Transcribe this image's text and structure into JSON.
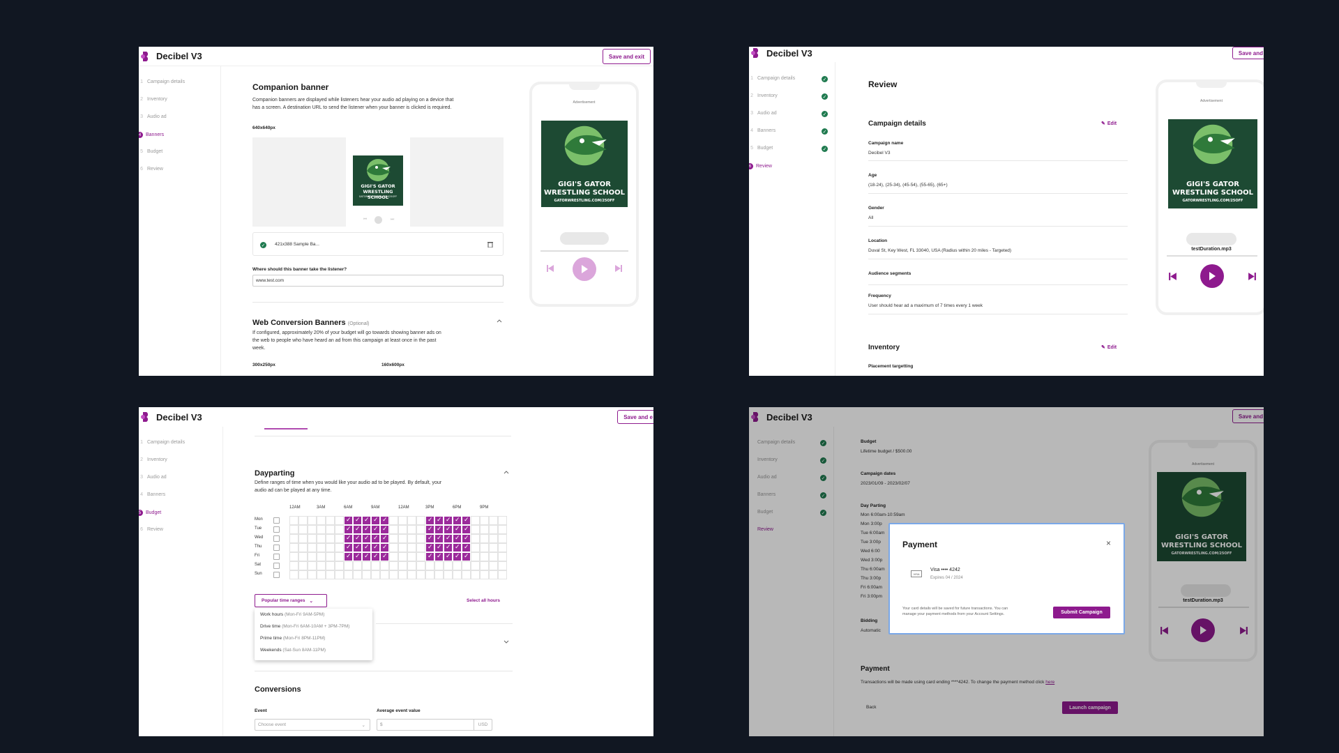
{
  "app": {
    "title": "Decibel V3",
    "save_exit": "Save and exit",
    "save_short": "Save and",
    "save_mid": "Save and e"
  },
  "colors": {
    "accent": "#8e1a8e",
    "background": "#111722",
    "check": "#1f7a4f"
  },
  "steps": [
    "Campaign details",
    "Inventory",
    "Audio ad",
    "Banners",
    "Budget",
    "Review"
  ],
  "step_numbers": [
    "1",
    "2",
    "3",
    "4",
    "5",
    "6"
  ],
  "ad_preview": {
    "advertisement": "Advertisement",
    "art_line1": "GIGI'S GATOR",
    "art_line2": "WRESTLING SCHOOL",
    "art_url": "GATORWRESTLING.COM/25OFF",
    "track_name": "testDuration.mp3"
  },
  "panel1": {
    "title": "Companion banner",
    "desc1": "Companion banners are displayed while listeners hear your audio ad playing on a device that",
    "desc2": "has a screen. A destination URL to send the listener when your banner is clicked is required.",
    "size_label": "640x640px",
    "file_name": "421x388 Sample Ba...",
    "url_label": "Where should this banner take the listener?",
    "url_value": "www.test.com",
    "web_title": "Web Conversion Banners",
    "web_optional": "(Optional)",
    "web_desc1": "If configured, approximately 20% of your budget will go towards showing banner ads on",
    "web_desc2": "the web to people who have heard an ad from this campaign at least once in the past",
    "web_desc3": "week.",
    "size_a": "300x250px",
    "size_b": "160x600px"
  },
  "panel2": {
    "title": "Review",
    "section1": "Campaign details",
    "edit": "Edit",
    "fields": [
      {
        "label": "Campaign name",
        "value": "Decibel V3"
      },
      {
        "label": "Age",
        "value": "(18-24), (25-34), (45-54), (55-65), (65+)"
      },
      {
        "label": "Gender",
        "value": "All"
      },
      {
        "label": "Location",
        "value": "Duval St, Key West, FL 33040, USA (Radius within 20 miles - Targeted)"
      },
      {
        "label": "Audience segments",
        "value": ""
      },
      {
        "label": "Frequency",
        "value": "User should hear ad a maximum of 7 times every 1 week"
      }
    ],
    "section2": "Inventory",
    "placement": "Placement targetting"
  },
  "panel3": {
    "title": "Dayparting",
    "desc1": "Define ranges of time when you would like your audio ad to be played. By default, your",
    "desc2": "audio ad can be played at any time.",
    "hours": [
      "12AM",
      "3AM",
      "6AM",
      "9AM",
      "12AM",
      "3PM",
      "6PM",
      "9PM"
    ],
    "days": [
      "Mon",
      "Tue",
      "Wed",
      "Thu",
      "Fri",
      "Sat",
      "Sun"
    ],
    "active_days": [
      "Mon",
      "Tue",
      "Wed",
      "Thu",
      "Fri"
    ],
    "active_hours": [
      6,
      7,
      8,
      9,
      10,
      15,
      16,
      17,
      18,
      19
    ],
    "popular": "Popular time ranges",
    "select_all": "Select all hours",
    "options": [
      {
        "name": "Work hours",
        "range": "(Mon-Fri 9AM-5PM)"
      },
      {
        "name": "Drive time",
        "range": "(Mon-Fri 6AM-10AM + 3PM-7PM)"
      },
      {
        "name": "Prime time",
        "range": "(Mon-Fri 8PM-11PM)"
      },
      {
        "name": "Weekends",
        "range": "(Sat-Sun 8AM-11PM)"
      }
    ],
    "conversions": "Conversions",
    "event_label": "Event",
    "event_placeholder": "Choose event",
    "avg_label": "Average event value",
    "currency_symbol": "$",
    "currency": "USD"
  },
  "panel4": {
    "budget_label": "Budget",
    "budget_value": "Lifetime budget / $500.00",
    "dates_label": "Campaign dates",
    "dates_value": "2023/01/09 - 2023/02/07",
    "daypart_label": "Day Parting",
    "daypart_lines": [
      "Mon 6:00am-10:59am",
      "Mon 3:00p",
      "Tue 6:00am",
      "Tue 3:00p",
      "Wed 6:00",
      "Wed 3:00p",
      "Thu 6:00am",
      "Thu 3:00p",
      "Fri 6:00am",
      "Fri 3:00pm"
    ],
    "bidding_label": "Bidding",
    "bidding_value": "Automatic",
    "payment_title": "Payment",
    "payment_text": "Transactions will be made using card ending ****4242. To change the payment method click",
    "payment_link": "here",
    "back": "Back",
    "launch": "Launch campaign",
    "modal": {
      "title": "Payment",
      "card": "Visa •••• 4242",
      "expires": "Expires 04 / 2024",
      "visa": "VISA",
      "note1": "Your card details will be saved for future transactions. You can",
      "note2": "manage your payment methods from your Account Settings.",
      "submit": "Submit Campaign"
    }
  }
}
